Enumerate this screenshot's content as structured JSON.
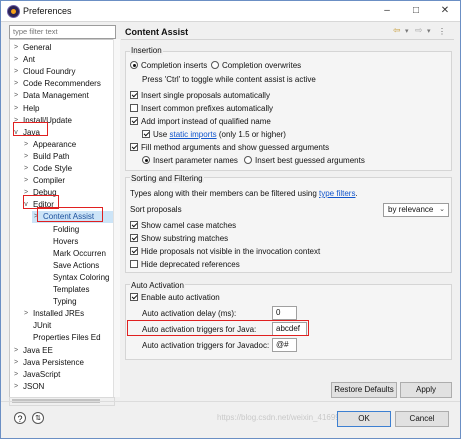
{
  "window": {
    "title": "Preferences"
  },
  "filter": {
    "placeholder": "type filter text"
  },
  "tree": {
    "items": [
      {
        "label": "General",
        "twisty": ">"
      },
      {
        "label": "Ant",
        "twisty": ">"
      },
      {
        "label": "Cloud Foundry",
        "twisty": ">"
      },
      {
        "label": "Code Recommenders",
        "twisty": ">"
      },
      {
        "label": "Data Management",
        "twisty": ">"
      },
      {
        "label": "Help",
        "twisty": ">"
      },
      {
        "label": "Install/Update",
        "twisty": ">"
      },
      {
        "label": "Java",
        "twisty": "v"
      },
      {
        "label": "Appearance",
        "twisty": ">"
      },
      {
        "label": "Build Path",
        "twisty": ">"
      },
      {
        "label": "Code Style",
        "twisty": ">"
      },
      {
        "label": "Compiler",
        "twisty": ">"
      },
      {
        "label": "Debug",
        "twisty": ">"
      },
      {
        "label": "Editor",
        "twisty": "v"
      },
      {
        "label": "Content Assist",
        "twisty": ">"
      },
      {
        "label": "Folding",
        "twisty": ""
      },
      {
        "label": "Hovers",
        "twisty": ""
      },
      {
        "label": "Mark Occurren",
        "twisty": ""
      },
      {
        "label": "Save Actions",
        "twisty": ""
      },
      {
        "label": "Syntax Coloring",
        "twisty": ""
      },
      {
        "label": "Templates",
        "twisty": ""
      },
      {
        "label": "Typing",
        "twisty": ""
      },
      {
        "label": "Installed JREs",
        "twisty": ">"
      },
      {
        "label": "JUnit",
        "twisty": ""
      },
      {
        "label": "Properties Files Ed",
        "twisty": ""
      },
      {
        "label": "Java EE",
        "twisty": ">"
      },
      {
        "label": "Java Persistence",
        "twisty": ">"
      },
      {
        "label": "JavaScript",
        "twisty": ">"
      },
      {
        "label": "JSON",
        "twisty": ">"
      }
    ]
  },
  "page": {
    "title": "Content Assist",
    "insertion": {
      "title": "Insertion",
      "completion_inserts": "Completion inserts",
      "completion_overwrites": "Completion overwrites",
      "toggle_hint": "Press 'Ctrl' to toggle while content assist is active",
      "insert_single": "Insert single proposals automatically",
      "insert_prefixes": "Insert common prefixes automatically",
      "add_import": "Add import instead of qualified name",
      "use_label": "Use",
      "static_imports_link": "static imports",
      "use_suffix": "(only 1.5 or higher)",
      "fill_method": "Fill method arguments and show guessed arguments",
      "insert_param_names": "Insert parameter names",
      "insert_best_guessed": "Insert best guessed arguments"
    },
    "sorting": {
      "title": "Sorting and Filtering",
      "filter_text": "Types along with their members can be filtered using",
      "type_filters_link": "type filters",
      "sort_proposals_label": "Sort proposals",
      "sort_value": "by relevance",
      "show_camel": "Show camel case matches",
      "show_substring": "Show substring matches",
      "hide_not_visible": "Hide proposals not visible in the invocation context",
      "hide_deprecated": "Hide deprecated references"
    },
    "auto": {
      "title": "Auto Activation",
      "enable": "Enable auto activation",
      "delay_label": "Auto activation delay (ms):",
      "delay_value": "0",
      "java_triggers_label": "Auto activation triggers for Java:",
      "java_triggers_value": "abcdef",
      "javadoc_triggers_label": "Auto activation triggers for Javadoc:",
      "javadoc_triggers_value": "@#"
    },
    "restore_defaults": "Restore Defaults",
    "apply": "Apply"
  },
  "footer": {
    "ok": "OK",
    "cancel": "Cancel",
    "watermark": "https://blog.csdn.net/weixin_41699337"
  },
  "colors": {
    "highlight": "#e02020",
    "link": "#1155cc",
    "selection": "#cce4f7"
  }
}
